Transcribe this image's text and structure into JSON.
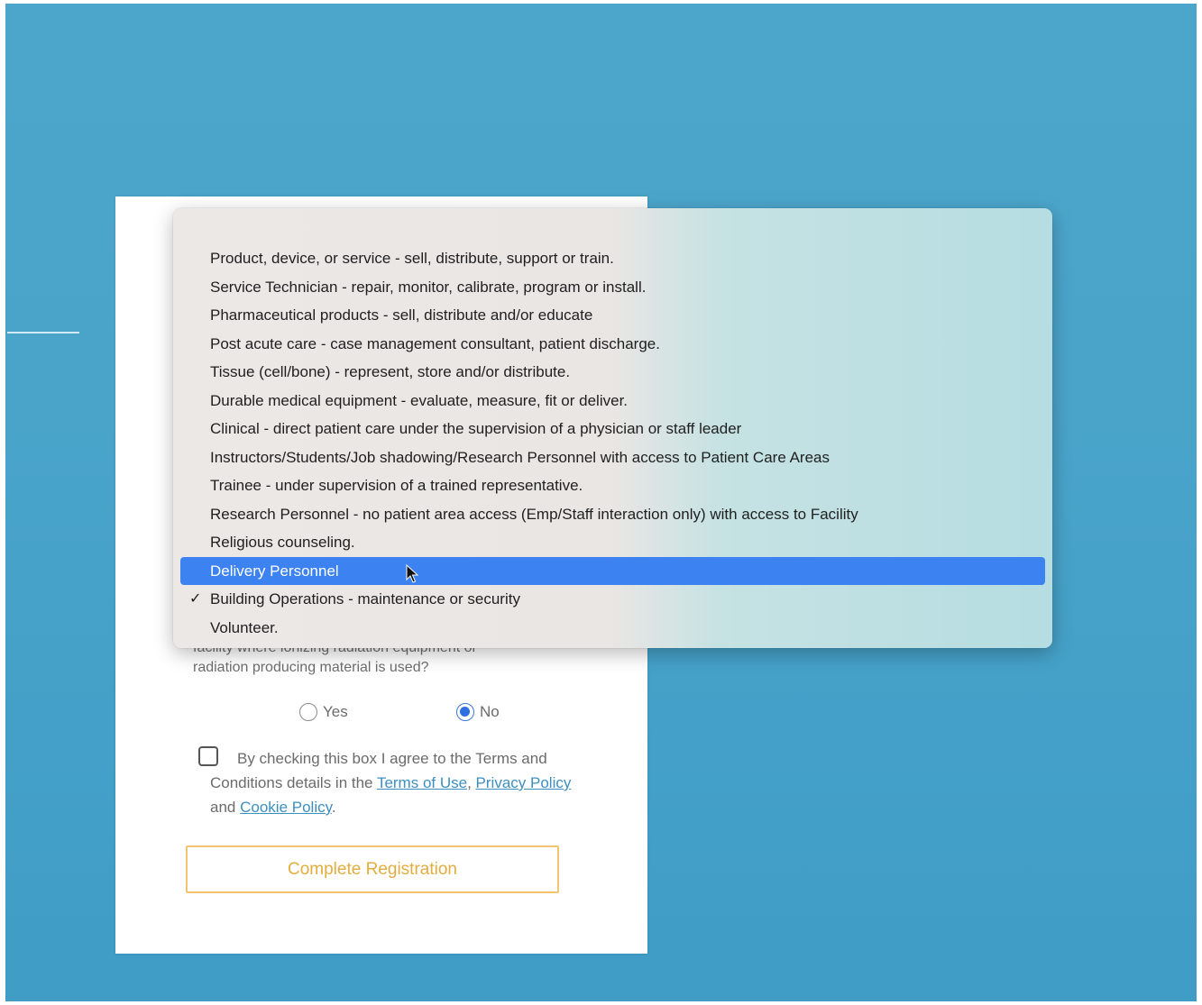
{
  "dropdown": {
    "items": [
      {
        "label": "Product, device, or service - sell, distribute, support or train.",
        "checked": false,
        "highlighted": false
      },
      {
        "label": "Service Technician - repair, monitor, calibrate, program or install.",
        "checked": false,
        "highlighted": false
      },
      {
        "label": "Pharmaceutical products - sell, distribute and/or educate",
        "checked": false,
        "highlighted": false
      },
      {
        "label": "Post acute care - case management consultant, patient discharge.",
        "checked": false,
        "highlighted": false
      },
      {
        "label": "Tissue (cell/bone) - represent, store and/or distribute.",
        "checked": false,
        "highlighted": false
      },
      {
        "label": "Durable medical equipment - evaluate, measure, fit or deliver.",
        "checked": false,
        "highlighted": false
      },
      {
        "label": "Clinical - direct patient care under the supervision of a physician or staff leader",
        "checked": false,
        "highlighted": false
      },
      {
        "label": "Instructors/Students/Job shadowing/Research Personnel with access to Patient Care Areas",
        "checked": false,
        "highlighted": false
      },
      {
        "label": "Trainee - under supervision of a trained representative.",
        "checked": false,
        "highlighted": false
      },
      {
        "label": "Research Personnel - no patient area access (Emp/Staff interaction only) with access to Facility",
        "checked": false,
        "highlighted": false
      },
      {
        "label": "Religious counseling.",
        "checked": false,
        "highlighted": false
      },
      {
        "label": "Delivery Personnel",
        "checked": false,
        "highlighted": true
      },
      {
        "label": "Building Operations - maintenance or security",
        "checked": true,
        "highlighted": false
      },
      {
        "label": "Volunteer.",
        "checked": false,
        "highlighted": false
      }
    ],
    "check_glyph": "✓",
    "highlight_color": "#3c82f0"
  },
  "form": {
    "radiation_question": "facility where ionizing radiation equipment or\nradiation producing material is used?",
    "radio_yes_label": "Yes",
    "radio_no_label": "No",
    "radio_selected": "No",
    "terms": {
      "checked": false,
      "text_prefix": "By checking this box I agree to the Terms and Conditions details in the",
      "terms_of_use_link": "Terms of Use",
      "comma": ",",
      "privacy_policy_link": "Privacy Policy",
      "and_text": "and",
      "cookie_policy_link": "Cookie Policy",
      "period": "."
    },
    "complete_button_label": "Complete Registration"
  },
  "colors": {
    "backdrop": "#4aa4ca",
    "button_border": "#f1c472",
    "button_text": "#e4ad3f",
    "link": "#3d8fc0",
    "radio_selected": "#2f6fe0"
  }
}
